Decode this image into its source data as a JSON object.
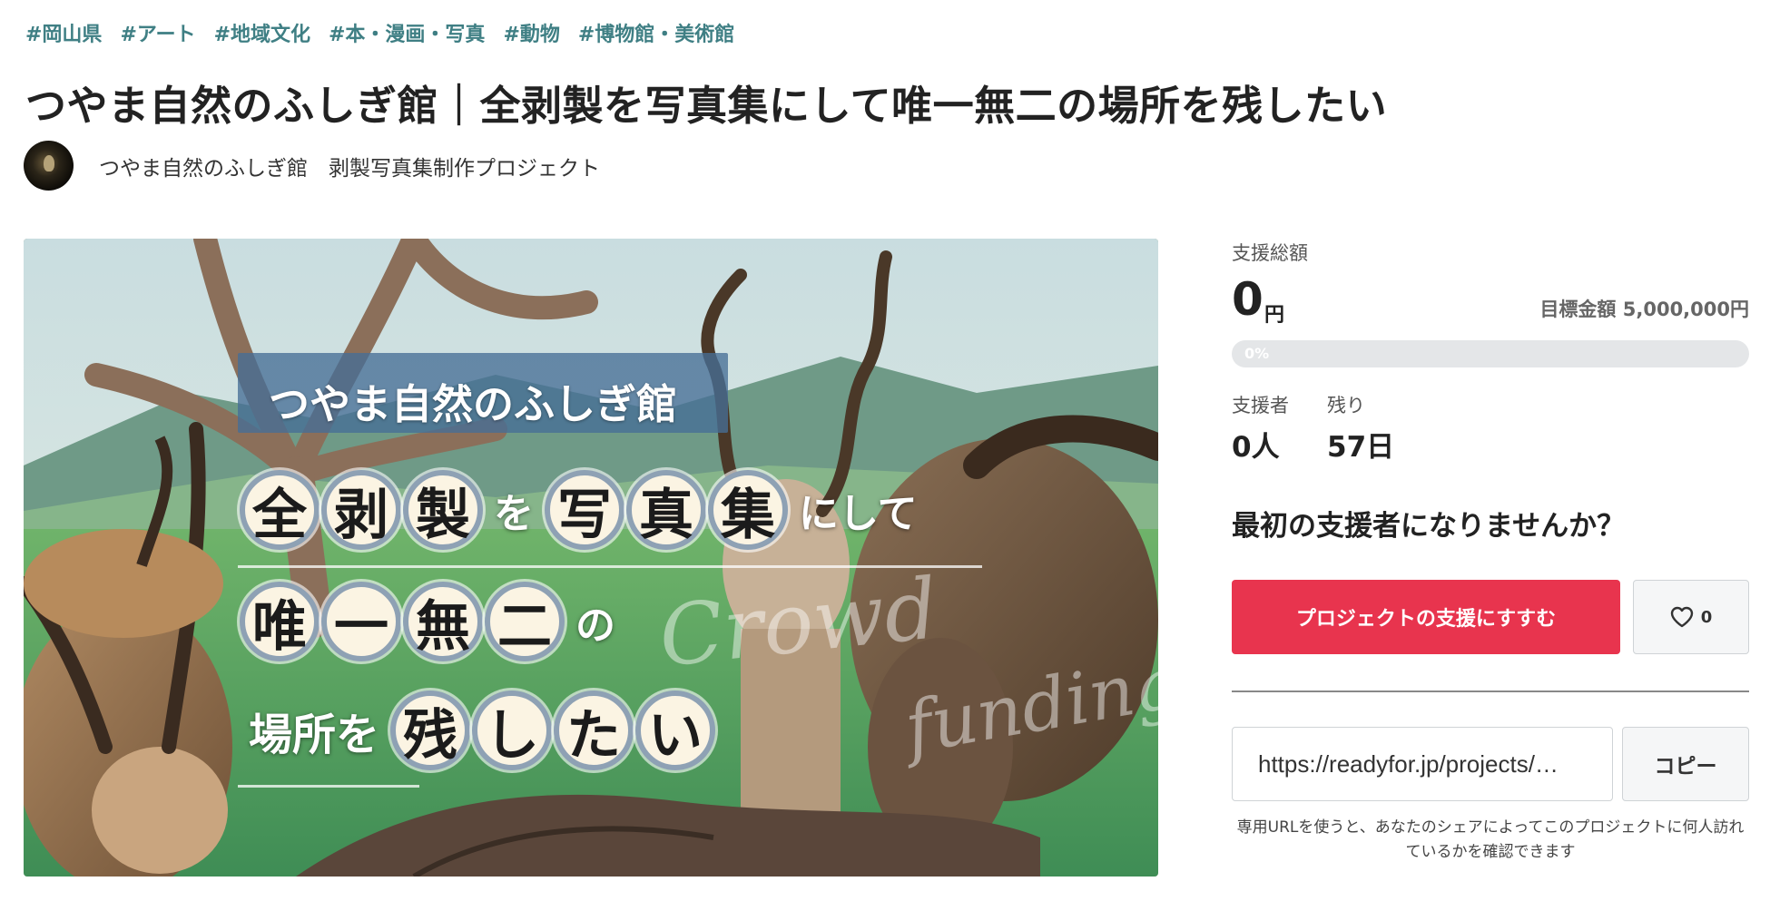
{
  "tags": [
    "#岡山県",
    "#アート",
    "#地域文化",
    "#本・漫画・写真",
    "#動物",
    "#博物館・美術館"
  ],
  "project": {
    "title": "つやま自然のふしぎ館｜全剥製を写真集にして唯一無二の場所を残したい",
    "owner_name": "つやま自然のふしぎ館　剥製写真集制作プロジェクト"
  },
  "hero": {
    "title": "つやま自然のふしぎ館",
    "line1_discs": [
      "全",
      "剥",
      "製"
    ],
    "line1_mid": "を",
    "line1_discs2": [
      "写",
      "真",
      "集"
    ],
    "line1_end": "にして",
    "line2_discs": [
      "唯",
      "一",
      "無",
      "二"
    ],
    "line2_end": "の",
    "line3_start": "場所を",
    "line3_discs": [
      "残",
      "し",
      "た",
      "い"
    ],
    "watermark1": "Crowd",
    "watermark2": "funding"
  },
  "funding": {
    "total_label": "支援総額",
    "amount": "0",
    "currency": "円",
    "goal_label": "目標金額",
    "goal_amount": "5,000,000円",
    "progress_text": "0%",
    "progress_fraction": 0,
    "supporters_label": "支援者",
    "supporters_value": "0人",
    "remaining_label": "残り",
    "remaining_value": "57日",
    "cta_message": "最初の支援者になりませんか？",
    "support_button": "プロジェクトの支援にすすむ",
    "favorite_count": "0"
  },
  "share": {
    "url": "https://readyfor.jp/projects/…",
    "copy_button": "コピー",
    "note": "専用URLを使うと、あなたのシェアによってこのプロジェクトに何人訪れているかを確認できます"
  },
  "colors": {
    "tag": "#3f7f84",
    "accent": "#e8344e",
    "progress_track": "#e4e6e8"
  }
}
